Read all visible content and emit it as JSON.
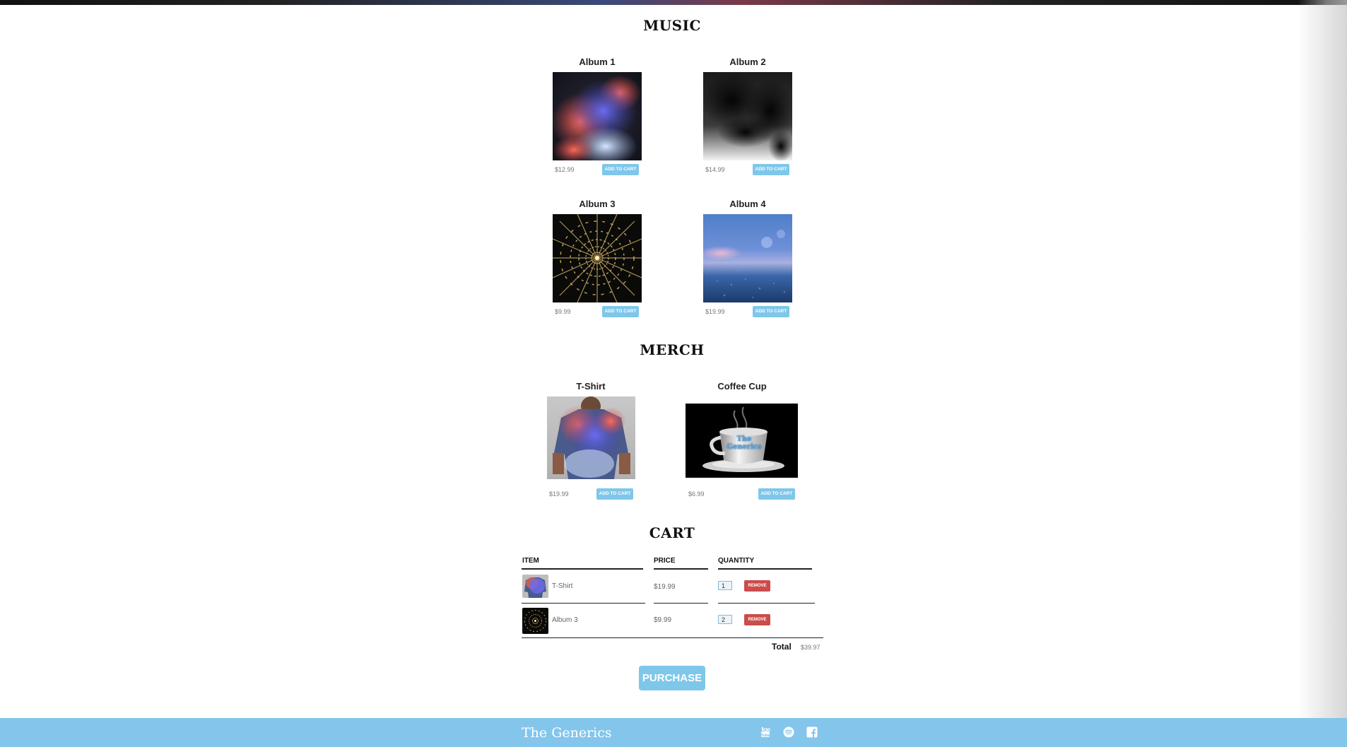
{
  "sections": {
    "music_title": "MUSIC",
    "merch_title": "MERCH",
    "cart_title": "CART"
  },
  "music": [
    {
      "name": "Album 1",
      "price": "$12.99",
      "button": "ADD TO CART"
    },
    {
      "name": "Album 2",
      "price": "$14.99",
      "button": "ADD TO CART"
    },
    {
      "name": "Album 3",
      "price": "$9.99",
      "button": "ADD TO CART"
    },
    {
      "name": "Album 4",
      "price": "$19.99",
      "button": "ADD TO CART"
    }
  ],
  "merch": [
    {
      "name": "T-Shirt",
      "price": "$19.99",
      "button": "ADD TO CART"
    },
    {
      "name": "Coffee Cup",
      "price": "$6.99",
      "button": "ADD TO CART",
      "cup_text": "The Generics"
    }
  ],
  "cart": {
    "headers": {
      "item": "ITEM",
      "price": "PRICE",
      "quantity": "QUANTITY"
    },
    "rows": [
      {
        "item": "T-Shirt",
        "price": "$19.99",
        "quantity": "1",
        "remove": "REMOVE"
      },
      {
        "item": "Album 3",
        "price": "$9.99",
        "quantity": "2",
        "remove": "REMOVE"
      }
    ],
    "total_label": "Total",
    "total_value": "$39.97",
    "purchase": "PURCHASE"
  },
  "footer": {
    "title": "The Generics",
    "icons": [
      "youtube-icon",
      "spotify-icon",
      "facebook-icon"
    ],
    "color": "#84c5ec"
  },
  "colors": {
    "accent": "#7fc7ea",
    "danger": "#cc4b4b"
  }
}
